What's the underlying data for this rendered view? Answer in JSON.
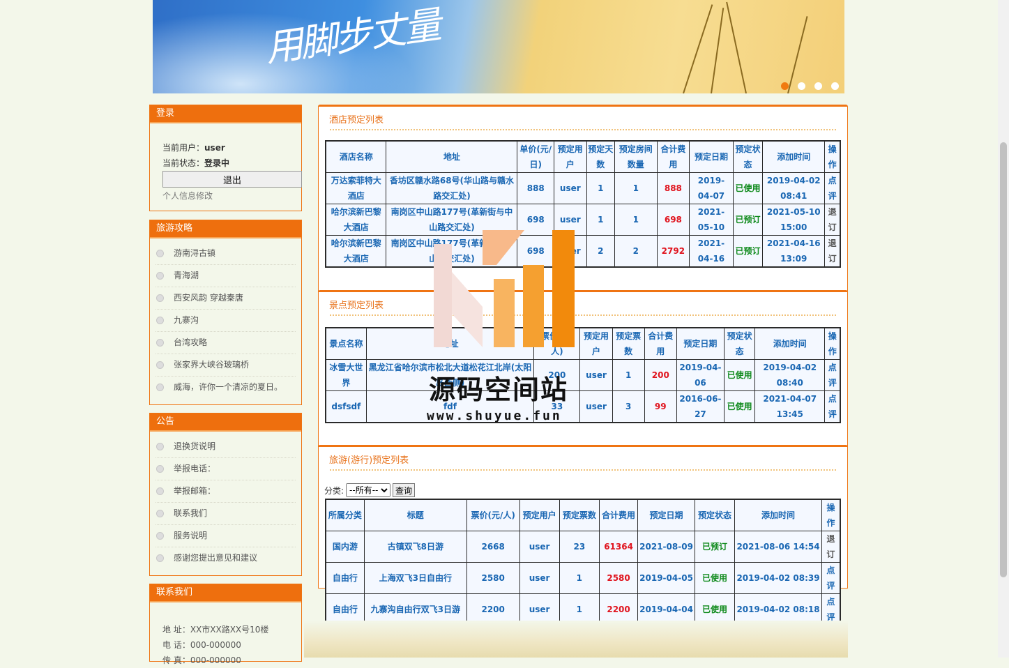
{
  "banner": {
    "script_text": "用脚步丈量",
    "dots": 4,
    "active_dot": 0
  },
  "login": {
    "title": "登录",
    "user_label": "当前用户：",
    "user_value": "user",
    "status_label": "当前状态：",
    "status_value": "登录中",
    "logout_label": "退出",
    "profile_link": "个人信息修改"
  },
  "guides": {
    "title": "旅游攻略",
    "items": [
      "游南浔古镇",
      "青海湖",
      "西安风韵 穿越秦唐",
      "九寨沟",
      "台湾攻略",
      "张家界大峡谷玻璃桥",
      "威海，许你一个清凉的夏日。"
    ]
  },
  "notices": {
    "title": "公告",
    "items": [
      "退换货说明",
      "举报电话：",
      "举报邮箱：",
      "联系我们",
      "服务说明",
      "感谢您提出意见和建议"
    ]
  },
  "contact": {
    "title": "联系我们",
    "address": "地 址：XX市XX路XX号10楼",
    "phone": "电 话：000-000000",
    "fax": "传 真：000-000000"
  },
  "hotel": {
    "title": "酒店预定列表",
    "headers": [
      "酒店名称",
      "地址",
      "单价(元/日)",
      "预定用户",
      "预定天数",
      "预定房间数量",
      "合计费用",
      "预定日期",
      "预定状态",
      "添加时间",
      "操作"
    ],
    "rows": [
      [
        "万达索菲特大酒店",
        "香坊区赣水路68号(华山路与赣水路交汇处)",
        "888",
        "user",
        "1",
        "1",
        "888",
        "2019-04-07",
        "已使用",
        "2019-04-02 08:41",
        "点评"
      ],
      [
        "哈尔滨新巴黎大酒店",
        "南岗区中山路177号(革新街与中山路交汇处)",
        "698",
        "user",
        "1",
        "1",
        "698",
        "2021-05-10",
        "已预订",
        "2021-05-10 15:00",
        "退订"
      ],
      [
        "哈尔滨新巴黎大酒店",
        "南岗区中山路177号(革新街与中山路交汇处)",
        "698",
        "user",
        "2",
        "2",
        "2792",
        "2021-04-16",
        "已预订",
        "2021-04-16 13:09",
        "退订"
      ]
    ]
  },
  "scenic": {
    "title": "景点预定列表",
    "headers": [
      "景点名称",
      "地址",
      "票价(元/人)",
      "预定用户",
      "预定票数",
      "合计费用",
      "预定日期",
      "预定状态",
      "添加时间",
      "操作"
    ],
    "rows": [
      [
        "冰雪大世界",
        "黑龙江省哈尔滨市松北大道松花江北岸(太阳岛西侧)",
        "200",
        "user",
        "1",
        "200",
        "2019-04-06",
        "已使用",
        "2019-04-02 08:40",
        "点评"
      ],
      [
        "dsfsdf",
        "fdf",
        "33",
        "user",
        "3",
        "99",
        "2016-06-27",
        "已使用",
        "2021-04-07 13:45",
        "点评"
      ]
    ]
  },
  "tour": {
    "title": "旅游(游行)预定列表",
    "filter_label": "分类:",
    "filter_selected": "--所有--",
    "query_label": "查询",
    "headers": [
      "所属分类",
      "标题",
      "票价(元/人)",
      "预定用户",
      "预定票数",
      "合计费用",
      "预定日期",
      "预定状态",
      "添加时间",
      "操作"
    ],
    "rows": [
      [
        "国内游",
        "古镇双飞8日游",
        "2668",
        "user",
        "23",
        "61364",
        "2021-08-09",
        "已预订",
        "2021-08-06 14:54",
        "退订"
      ],
      [
        "自由行",
        "上海双飞3日自由行",
        "2580",
        "user",
        "1",
        "2580",
        "2019-04-05",
        "已使用",
        "2019-04-02 08:39",
        "点评"
      ],
      [
        "自由行",
        "九寨沟自由行双飞3日游",
        "2200",
        "user",
        "1",
        "2200",
        "2019-04-04",
        "已使用",
        "2019-04-02 08:18",
        "点评"
      ]
    ]
  },
  "watermark": {
    "text": "源码空间站",
    "url": "www.shuyue.fun"
  },
  "colors": {
    "accent": "#ee6f0e",
    "link": "#1a67b3",
    "cost": "#e0141e",
    "status": "#0f8a1c"
  }
}
